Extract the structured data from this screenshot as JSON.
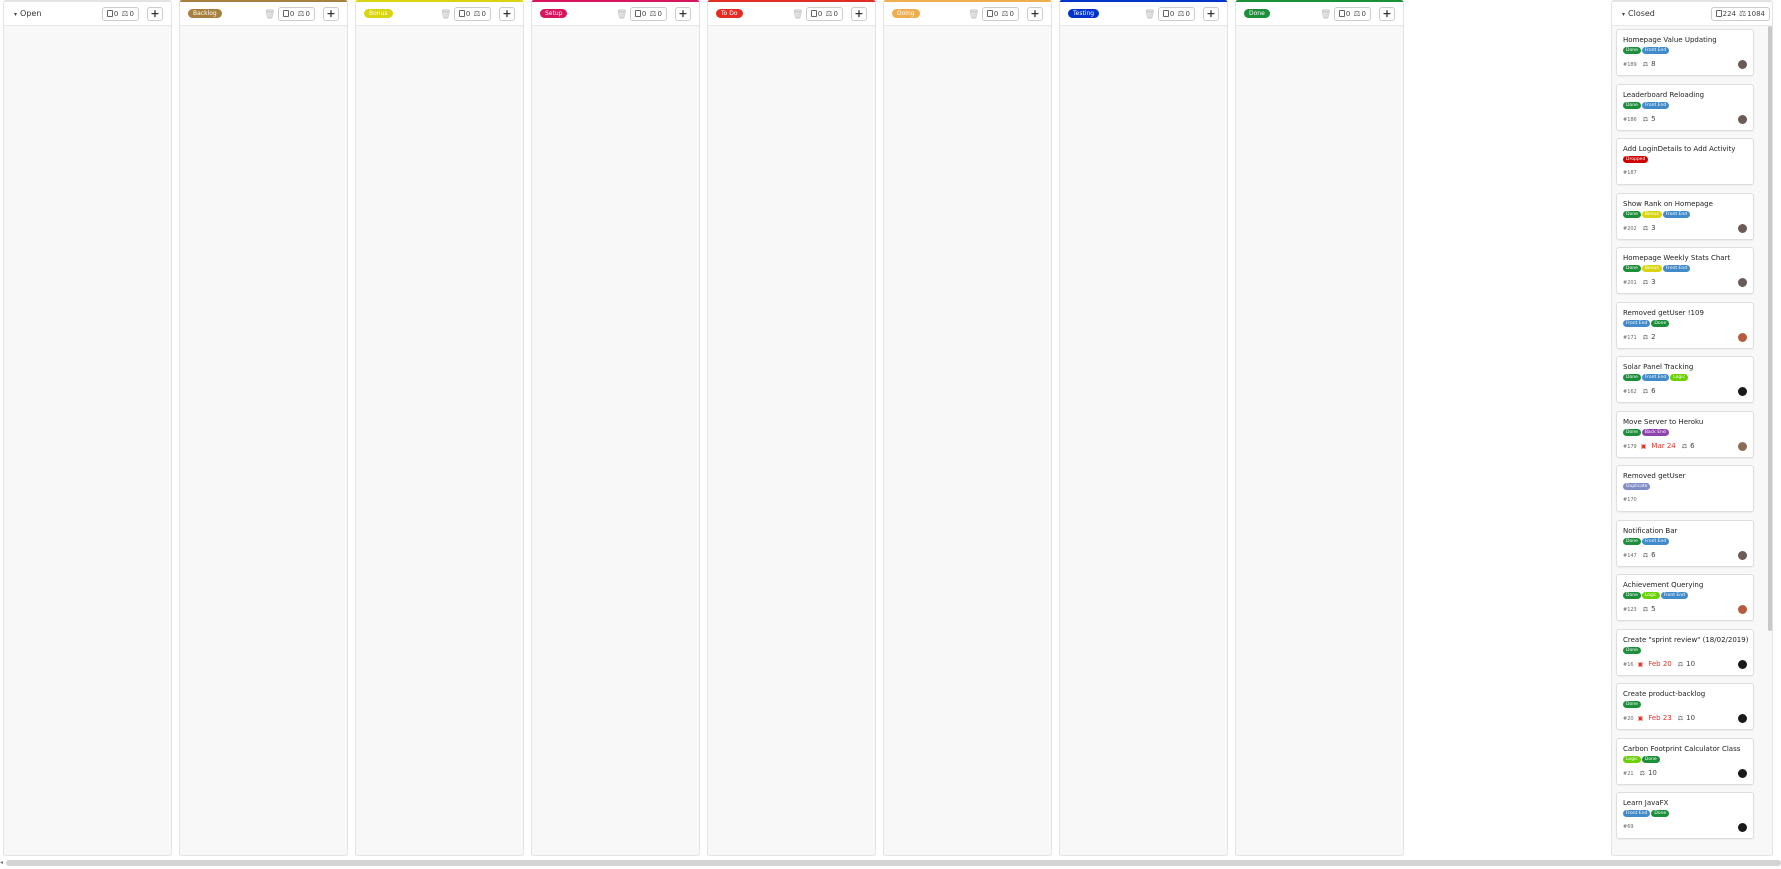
{
  "columns": [
    {
      "title": "Open",
      "color": "",
      "issues": "0",
      "weight": "0",
      "is_open": true
    },
    {
      "title": "Backlog",
      "color": "#a8803d",
      "issues": "0",
      "weight": "0"
    },
    {
      "title": "Bonus",
      "color": "#d9d411",
      "issues": "0",
      "weight": "0"
    },
    {
      "title": "Setup",
      "color": "#d8145e",
      "issues": "0",
      "weight": "0"
    },
    {
      "title": "To Do",
      "color": "#e42c22",
      "issues": "0",
      "weight": "0"
    },
    {
      "title": "Doing",
      "color": "#f0ad4e",
      "issues": "0",
      "weight": "0"
    },
    {
      "title": "Testing",
      "color": "#0033cc",
      "issues": "0",
      "weight": "0"
    },
    {
      "title": "Done",
      "color": "#1c8f3a",
      "issues": "0",
      "weight": "0"
    }
  ],
  "closed": {
    "title": "Closed",
    "issues": "224",
    "weight": "1084",
    "cards": [
      {
        "title": "Homepage Value Updating",
        "tags": [
          "Done",
          "Front End"
        ],
        "id": "#189",
        "due": "",
        "weight": "8",
        "avatar": "#6b5a55"
      },
      {
        "title": "Leaderboard Reloading",
        "tags": [
          "Done",
          "Front End"
        ],
        "id": "#186",
        "due": "",
        "weight": "5",
        "avatar": "#6b5a55"
      },
      {
        "title": "Add LoginDetails to Add Activity",
        "tags": [
          "Dropped"
        ],
        "id": "#187",
        "due": "",
        "weight": "",
        "avatar": ""
      },
      {
        "title": "Show Rank on Homepage",
        "tags": [
          "Done",
          "Bonus",
          "Front End"
        ],
        "id": "#202",
        "due": "",
        "weight": "3",
        "avatar": "#6b5a55"
      },
      {
        "title": "Homepage Weekly Stats Chart",
        "tags": [
          "Done",
          "Bonus",
          "Front End"
        ],
        "id": "#201",
        "due": "",
        "weight": "3",
        "avatar": "#6b5a55"
      },
      {
        "title": "Removed getUser !109",
        "tags": [
          "Front End",
          "Done"
        ],
        "id": "#171",
        "due": "",
        "weight": "2",
        "avatar": "#b65a40"
      },
      {
        "title": "Solar Panel Tracking",
        "tags": [
          "Done",
          "Front End",
          "Logic"
        ],
        "id": "#162",
        "due": "",
        "weight": "6",
        "avatar": "#1a1a1a"
      },
      {
        "title": "Move Server to Heroku",
        "tags": [
          "Done",
          "Back End"
        ],
        "id": "#179",
        "due": "Mar 24",
        "weight": "6",
        "avatar": "#8a6a55"
      },
      {
        "title": "Removed getUser",
        "tags": [
          "Duplicate"
        ],
        "id": "#170",
        "due": "",
        "weight": "",
        "avatar": ""
      },
      {
        "title": "Notification Bar",
        "tags": [
          "Done",
          "Front End"
        ],
        "id": "#147",
        "due": "",
        "weight": "6",
        "avatar": "#6b5a55"
      },
      {
        "title": "Achievement Querying",
        "tags": [
          "Done",
          "Logic",
          "Front End"
        ],
        "id": "#123",
        "due": "",
        "weight": "5",
        "avatar": "#b65a40"
      },
      {
        "title": "Create \"sprint review\" (18/02/2019)",
        "tags": [
          "Done"
        ],
        "id": "#16",
        "due": "Feb 20",
        "weight": "10",
        "avatar": "#1a1a1a"
      },
      {
        "title": "Create product-backlog",
        "tags": [
          "Done"
        ],
        "id": "#20",
        "due": "Feb 23",
        "weight": "10",
        "avatar": "#1a1a1a"
      },
      {
        "title": "Carbon Footprint Calculator Class",
        "tags": [
          "Logic",
          "Done"
        ],
        "id": "#21",
        "due": "",
        "weight": "10",
        "avatar": "#1a1a1a"
      },
      {
        "title": "Learn JavaFX",
        "tags": [
          "Front End",
          "Done"
        ],
        "id": "#69",
        "due": "",
        "weight": "",
        "avatar": "#1a1a1a"
      }
    ]
  },
  "tag_colors": {
    "Done": "#1c8f3a",
    "Front End": "#428bca",
    "Dropped": "#d10000",
    "Bonus": "#d9d411",
    "Logic": "#69d100",
    "Back End": "#8e44ad",
    "Duplicate": "#7f8cc7"
  },
  "icons": {
    "caret": "▾",
    "trash": "🗑",
    "plus": "+",
    "weight": "⚖",
    "calendar": "▣"
  }
}
